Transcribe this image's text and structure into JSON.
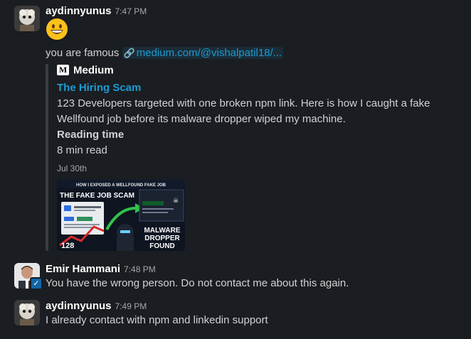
{
  "messages": [
    {
      "author": "aydinnyunus",
      "time": "7:47 PM",
      "emoji": "grinning-face",
      "text_prefix": "you are famous",
      "link_text": "medium.com/@vishalpatil18/...",
      "unfurl": {
        "site_logo": "M",
        "site_name": "Medium",
        "title": "The Hiring Scam",
        "description": "123 Developers targeted with one broken npm link. Here is how I caught a fake Wellfound job before its malware dropper wiped my machine.",
        "field_label": "Reading time",
        "field_value": "8 min read",
        "date": "Jul 30th",
        "thumbnail": {
          "header": "HOW I EXPOSED A WELLFOUND FAKE JOB",
          "headline": "THE FAKE JOB SCAM",
          "count": "128",
          "stamp_lines": [
            "MALWARE",
            "DROPPER",
            "FOUND"
          ]
        }
      }
    },
    {
      "author": "Emir Hammani",
      "time": "7:48 PM",
      "text": "You have the wrong person. Do not contact me about this again."
    },
    {
      "author": "aydinnyunus",
      "time": "7:49 PM",
      "text": "I already contact with npm and linkedin support"
    }
  ],
  "colors": {
    "background": "#1a1d21",
    "link": "#1d9bd1",
    "text": "#d1d2d3",
    "muted": "#a5a6a8"
  }
}
